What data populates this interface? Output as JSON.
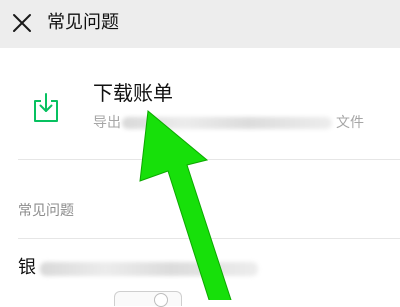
{
  "header": {
    "title": "常见问题",
    "close_icon": "close-icon"
  },
  "download_bill": {
    "title": "下载账单",
    "description_prefix": "导出",
    "description_suffix": "文件",
    "icon": "download-icon",
    "accent_color": "#07c160"
  },
  "faq_section": {
    "label": "常见问题",
    "items": [
      {
        "visible_text": "银"
      }
    ]
  },
  "overlay": {
    "annotation": "green-arrow-icon",
    "color": "#17e00a"
  }
}
